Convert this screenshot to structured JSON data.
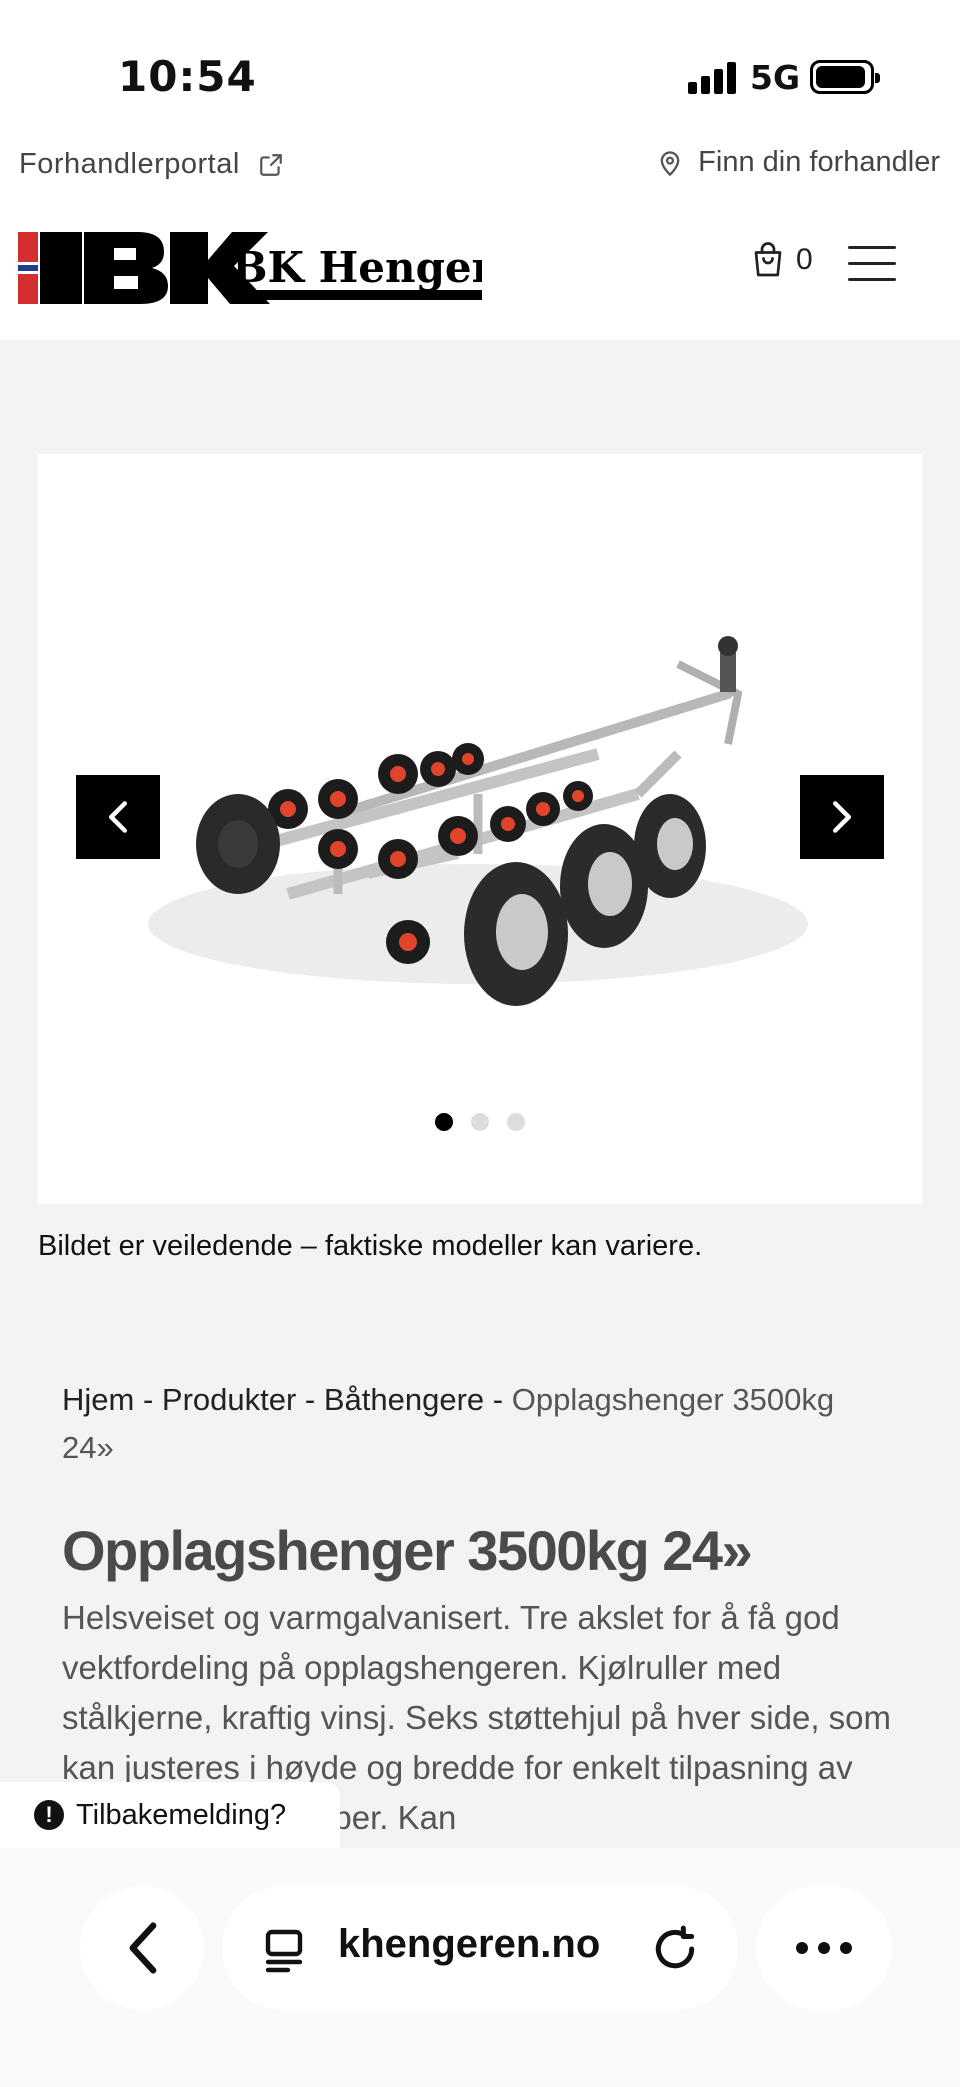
{
  "status_bar": {
    "time": "10:54",
    "network": "5G",
    "icons": [
      "signal-icon",
      "battery-icon"
    ]
  },
  "top_links": {
    "dealer_portal": "Forhandlerportal",
    "find_dealer": "Finn din forhandler",
    "icons": [
      "external-link-icon",
      "location-pin-icon"
    ]
  },
  "header": {
    "logo_text": "BK Hengeren",
    "cart_count": "0",
    "icons": [
      "cart-icon",
      "hamburger-menu-icon"
    ]
  },
  "gallery": {
    "slide_count": 3,
    "active_slide": 1,
    "caption": "Bildet er veiledende – faktiske modeller kan variere.",
    "icons": [
      "chevron-left-icon",
      "chevron-right-icon"
    ]
  },
  "breadcrumb": {
    "items": [
      "Hjem",
      "Produkter",
      "Båthengere"
    ],
    "separator": " - ",
    "current": "Opplagshenger 3500kg 24»"
  },
  "product": {
    "title": "Opplagshenger 3500kg 24»",
    "description": "Helsveiset og varmgalvanisert. Tre akslet for å få god vektfordeling på opplagshengeren. Kjølruller med stålkjerne, kraftig vinsj. Seks støttehjul på hver side, som kan justeres i høyde og bredde for enkelt tilpasning av forskjellige skrogtyper. Kan"
  },
  "feedback": {
    "label": "Tilbakemelding?"
  },
  "browser": {
    "url": "khengeren.no",
    "icons": [
      "back-chevron-icon",
      "tabs-icon",
      "reload-icon",
      "more-dots-icon"
    ]
  },
  "colors": {
    "brand_red": "#d42f2f",
    "brand_blue": "#1f3e8c",
    "page_grey": "#f3f3f3",
    "black": "#000000"
  }
}
